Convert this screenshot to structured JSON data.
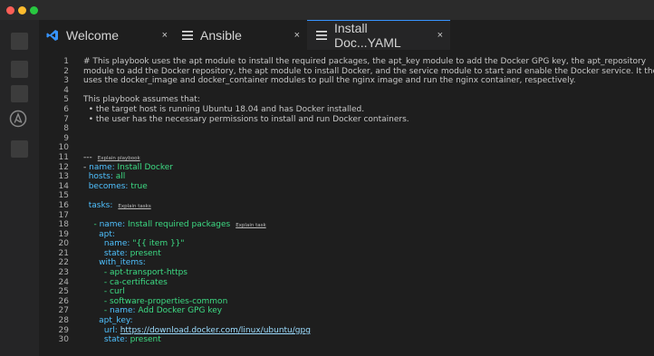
{
  "window": {
    "controls": [
      "close",
      "minimize",
      "zoom"
    ]
  },
  "activity_bar": {
    "items": [
      "explorer-icon",
      "search-icon",
      "scm-icon",
      "ansible-icon",
      "extensions-icon"
    ]
  },
  "tabs": [
    {
      "label": "Welcome",
      "icon": "vscode-icon",
      "close": "×"
    },
    {
      "label": "Ansible",
      "icon": "menu-icon",
      "close": "×"
    },
    {
      "label": "Install Doc...YAML",
      "icon": "menu-icon",
      "close": "×",
      "active": true
    }
  ],
  "colors": {
    "accent": "#3794ff",
    "key": "#4fc1ff",
    "value": "#3ddc84"
  },
  "editor": {
    "line_numbers": [
      "1",
      "2",
      "3",
      "4",
      "5",
      "6",
      "7",
      "8",
      "9",
      "10",
      "11",
      "12",
      "13",
      "14",
      "15",
      "16",
      "17",
      "18",
      "19",
      "20",
      "21",
      "22",
      "23",
      "24",
      "25",
      "26",
      "27",
      "28",
      "29",
      "30"
    ],
    "lines": {
      "l1": "# This playbook uses the apt module to install the required packages, the apt_key module to add the Docker GPG key, the apt_repository",
      "l2": "module to add the Docker repository, the apt module to install Docker, and the service module to start and enable the Docker service. It then",
      "l3": "uses the docker_image and docker_container modules to pull the nginx image and run the nginx container, respectively.",
      "l5": "This playbook assumes that:",
      "l6": "  • the target host is running Ubuntu 18.04 and has Docker installed.",
      "l7": "  • the user has the necessary permissions to install and run Docker containers.",
      "l11_text": "---",
      "l11_lens": "Explain playbook",
      "l12_dash": "- ",
      "l12_key": "name:",
      "l12_val": " Install Docker",
      "l13_key": "  hosts:",
      "l13_val": " all",
      "l14_key": "  becomes:",
      "l14_val": " true",
      "l16_key": "  tasks:",
      "l16_lens": "Explain tasks",
      "l18_dash": "    - ",
      "l18_key": "name:",
      "l18_val": " Install required packages",
      "l18_lens": "Explain task",
      "l19_key": "      apt:",
      "l20_key": "        name:",
      "l20_val": " \"{{ item }}\"",
      "l21_key": "        state:",
      "l21_val": " present",
      "l22_key": "      with_items:",
      "l23": "        - apt-transport-https",
      "l24": "        - ca-certificates",
      "l25": "        - curl",
      "l26": "        - software-properties-common",
      "l27_dash": "        - ",
      "l27_key": "name:",
      "l27_val": " Add Docker GPG key",
      "l28_key": "      apt_key:",
      "l29_key": "        url:",
      "l29_val": "https://download.docker.com/linux/ubuntu/gpg",
      "l30_key": "        state:",
      "l30_val": " present"
    }
  }
}
